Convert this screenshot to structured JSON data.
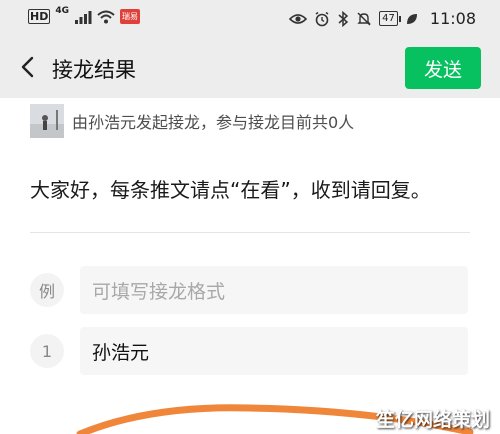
{
  "status_bar": {
    "hd": "HD",
    "network": "4G",
    "notify_badge": "瑞易",
    "battery": "47",
    "time": "11:08"
  },
  "nav": {
    "title": "接龙结果",
    "send_label": "发送"
  },
  "initiator_text": "由孙浩元发起接龙，参与接龙目前共0人",
  "message": "大家好，每条推文请点“在看”，收到请回复。",
  "entries": [
    {
      "number": "例",
      "placeholder": "可填写接龙格式",
      "value": ""
    },
    {
      "number": "1",
      "placeholder": "",
      "value": "孙浩元"
    }
  ],
  "watermark": "笙亿网络策划",
  "colors": {
    "accent": "#07c160",
    "annotation": "#f0863a"
  }
}
